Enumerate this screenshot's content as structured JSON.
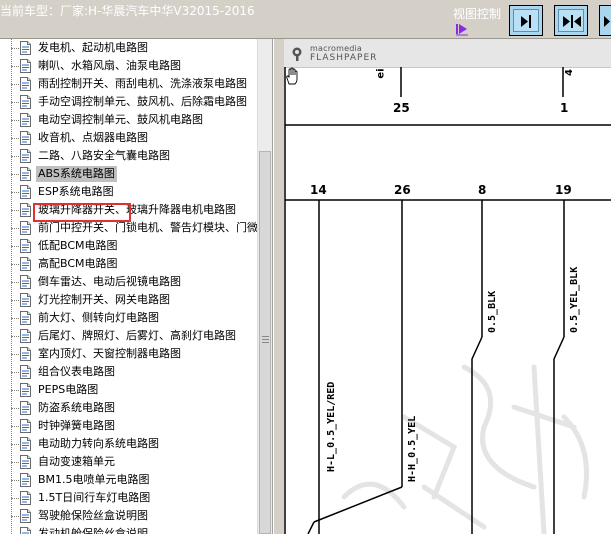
{
  "header": {
    "title": "当前车型：厂家:H-华晨汽车中华V32015-2016",
    "view_control_label": "视图控制",
    "buttons": [
      {
        "name": "fit-width",
        "icon": "fit-width-icon"
      },
      {
        "name": "fit-page",
        "icon": "fit-page-icon"
      },
      {
        "name": "zoom",
        "icon": "zoom-icon"
      }
    ]
  },
  "sidebar": {
    "items": [
      {
        "label": "发电机、起动机电路图"
      },
      {
        "label": "喇叭、水箱风扇、油泵电路图"
      },
      {
        "label": "雨刮控制开关、雨刮电机、洗涤液泵电路图"
      },
      {
        "label": "手动空调控制单元、鼓风机、后除霜电路图"
      },
      {
        "label": "电动空调控制单元、鼓风机电路图"
      },
      {
        "label": "收音机、点烟器电路图"
      },
      {
        "label": "二路、八路安全气囊电路图"
      },
      {
        "label": "ABS系统电路图",
        "selected": true
      },
      {
        "label": "ESP系统电路图"
      },
      {
        "label": "玻璃升降器开关、玻璃升降器电机电路图"
      },
      {
        "label": "前门中控开关、门锁电机、警告灯模块、门微"
      },
      {
        "label": "低配BCM电路图"
      },
      {
        "label": "高配BCM电路图"
      },
      {
        "label": "倒车雷达、电动后视镜电路图"
      },
      {
        "label": "灯光控制开关、网关电路图"
      },
      {
        "label": "前大灯、侧转向灯电路图"
      },
      {
        "label": "后尾灯、牌照灯、后雾灯、高刹灯电路图"
      },
      {
        "label": "室内顶灯、天窗控制器电路图"
      },
      {
        "label": "组合仪表电路图"
      },
      {
        "label": "PEPS电路图"
      },
      {
        "label": "防盗系统电路图"
      },
      {
        "label": "时钟弹簧电路图"
      },
      {
        "label": "电动助力转向系统电路图"
      },
      {
        "label": "自动变速箱单元"
      },
      {
        "label": "BM1.5电喷单元电路图"
      },
      {
        "label": "1.5T日间行车灯电路图"
      },
      {
        "label": "驾驶舱保险丝盒说明图"
      },
      {
        "label": "发动机舱保险丝盒说明"
      }
    ]
  },
  "viewer": {
    "brand_top": "macromedia",
    "brand_name": "FLASHPAPER",
    "diagram": {
      "top_labels": [
        "ei",
        "4"
      ],
      "pins_row1": [
        "25",
        "1"
      ],
      "pins_row2": [
        "14",
        "26",
        "8",
        "19"
      ],
      "wire_labels": [
        "H-L_0.5_YEL/RED",
        "H-H_0.5_YEL",
        "0.5_BLK",
        "0.5_YEL_BLK"
      ]
    }
  },
  "colors": {
    "chrome": "#d4d0c8",
    "button": "#a9d6ee",
    "selection_box": "#e03030",
    "arrow": "#8a2be2"
  }
}
